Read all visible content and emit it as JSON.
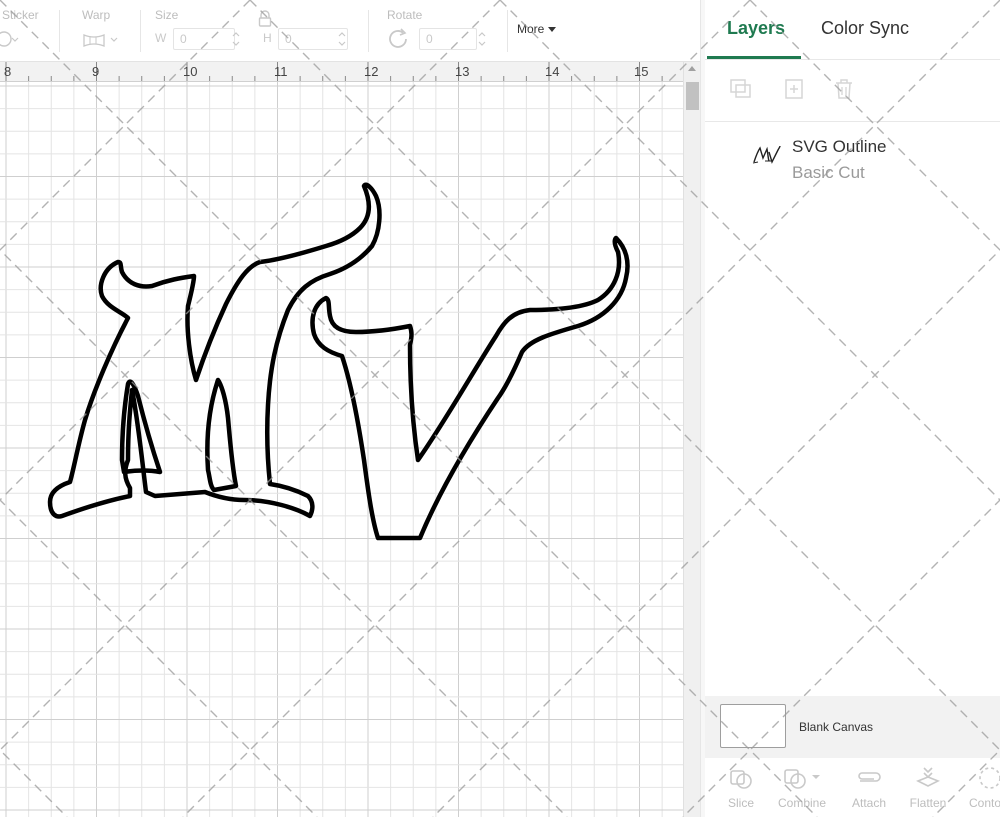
{
  "toolbar": {
    "sticker_label": "Sticker",
    "warp_label": "Warp",
    "size_label": "Size",
    "size_w_label": "W",
    "size_w_value": "0",
    "size_h_label": "H",
    "size_h_value": "0",
    "rotate_label": "Rotate",
    "rotate_value": "0",
    "more_label": "More"
  },
  "ruler": {
    "numbers": [
      "8",
      "9",
      "10",
      "11",
      "12",
      "13",
      "14",
      "15"
    ]
  },
  "panel": {
    "tabs": [
      {
        "label": "Layers",
        "active": true
      },
      {
        "label": "Color Sync",
        "active": false
      }
    ],
    "layer_actions": [
      "group-icon",
      "add-icon",
      "delete-icon"
    ],
    "layers": [
      {
        "name": "SVG Outline",
        "operation": "Basic Cut",
        "thumbnail": "mv-logo-thumbnail"
      }
    ],
    "blank_canvas_label": "Blank Canvas",
    "bottom_actions": [
      {
        "label": "Slice",
        "icon": "slice-icon"
      },
      {
        "label": "Combine",
        "icon": "combine-icon"
      },
      {
        "label": "Attach",
        "icon": "attach-icon"
      },
      {
        "label": "Flatten",
        "icon": "flatten-icon"
      },
      {
        "label": "Contour",
        "icon": "contour-icon"
      }
    ]
  },
  "colors": {
    "accent": "#1f7a50",
    "grid_minor": "#e4e4e4",
    "grid_major": "#cfcfcf",
    "outline": "#000000"
  }
}
